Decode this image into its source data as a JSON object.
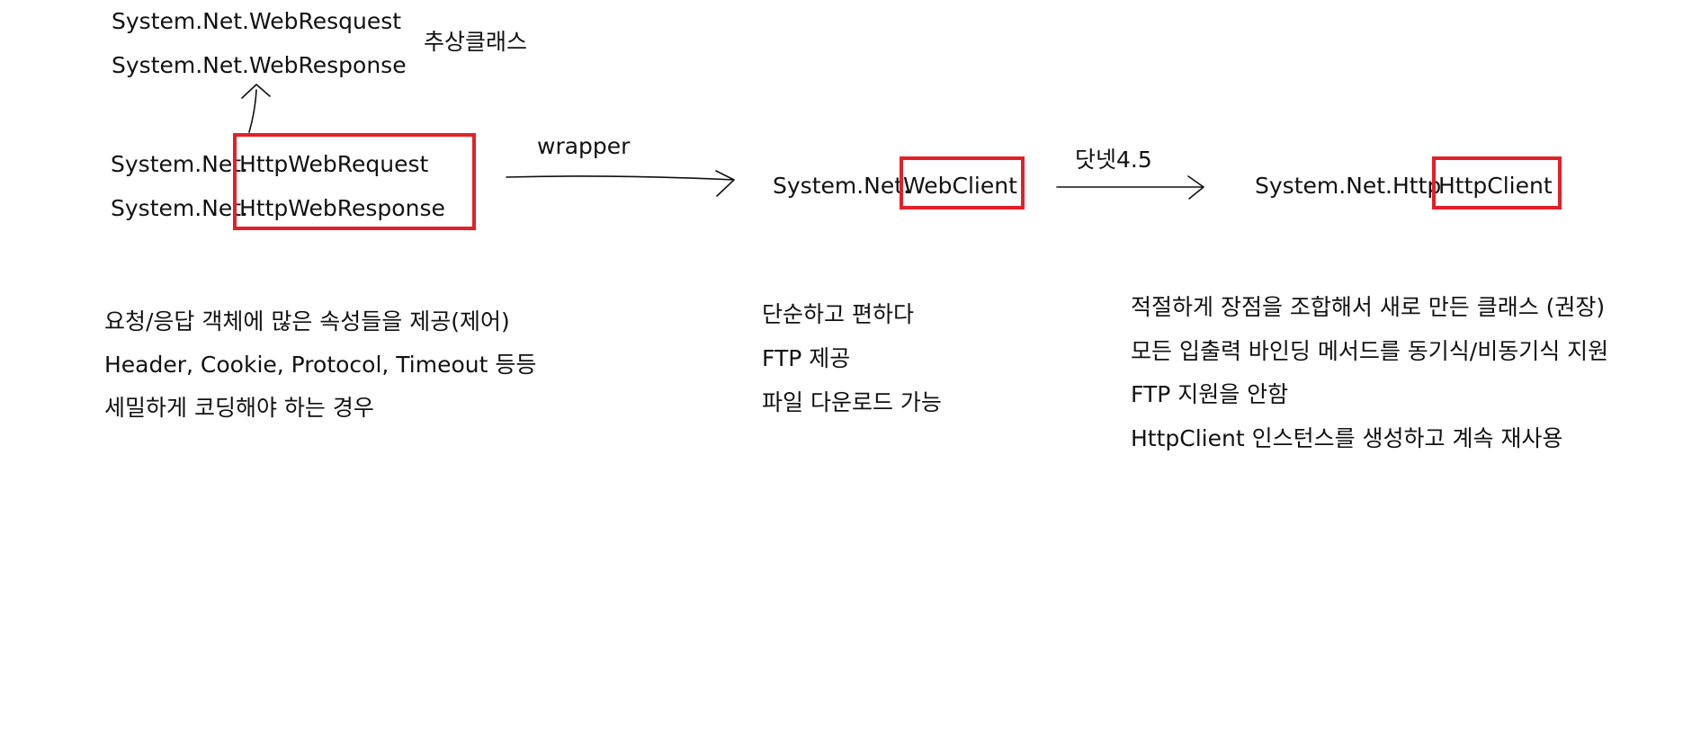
{
  "abstract": {
    "line1": "System.Net.WebResquest",
    "line2": "System.Net.WebResponse",
    "label": "추상클래스"
  },
  "http_web": {
    "prefix": "System.Net.",
    "request": "HttpWebRequest",
    "response": "HttpWebResponse",
    "notes": [
      "요청/응답 객체에 많은 속성들을 제공(제어)",
      "Header, Cookie, Protocol, Timeout 등등",
      "세밀하게 코딩해야 하는 경우"
    ]
  },
  "arrow_wrapper_label": "wrapper",
  "web_client": {
    "prefix": "System.Net.",
    "name": "WebClient",
    "notes": [
      "단순하고 편하다",
      "FTP 제공",
      "파일 다운로드 가능"
    ]
  },
  "arrow_dotnet_label": "닷넷4.5",
  "http_client": {
    "prefix": "System.Net.Http",
    "name": "HttpClient",
    "notes": [
      "적절하게 장점을 조합해서 새로 만든 클래스 (권장)",
      "모든 입출력 바인딩 메서드를 동기식/비동기식 지원",
      "FTP 지원을 안함",
      "HttpClient 인스턴스를 생성하고 계속 재사용"
    ]
  },
  "colors": {
    "highlight_box": "#e32028",
    "text": "#111111",
    "background": "#ffffff"
  }
}
